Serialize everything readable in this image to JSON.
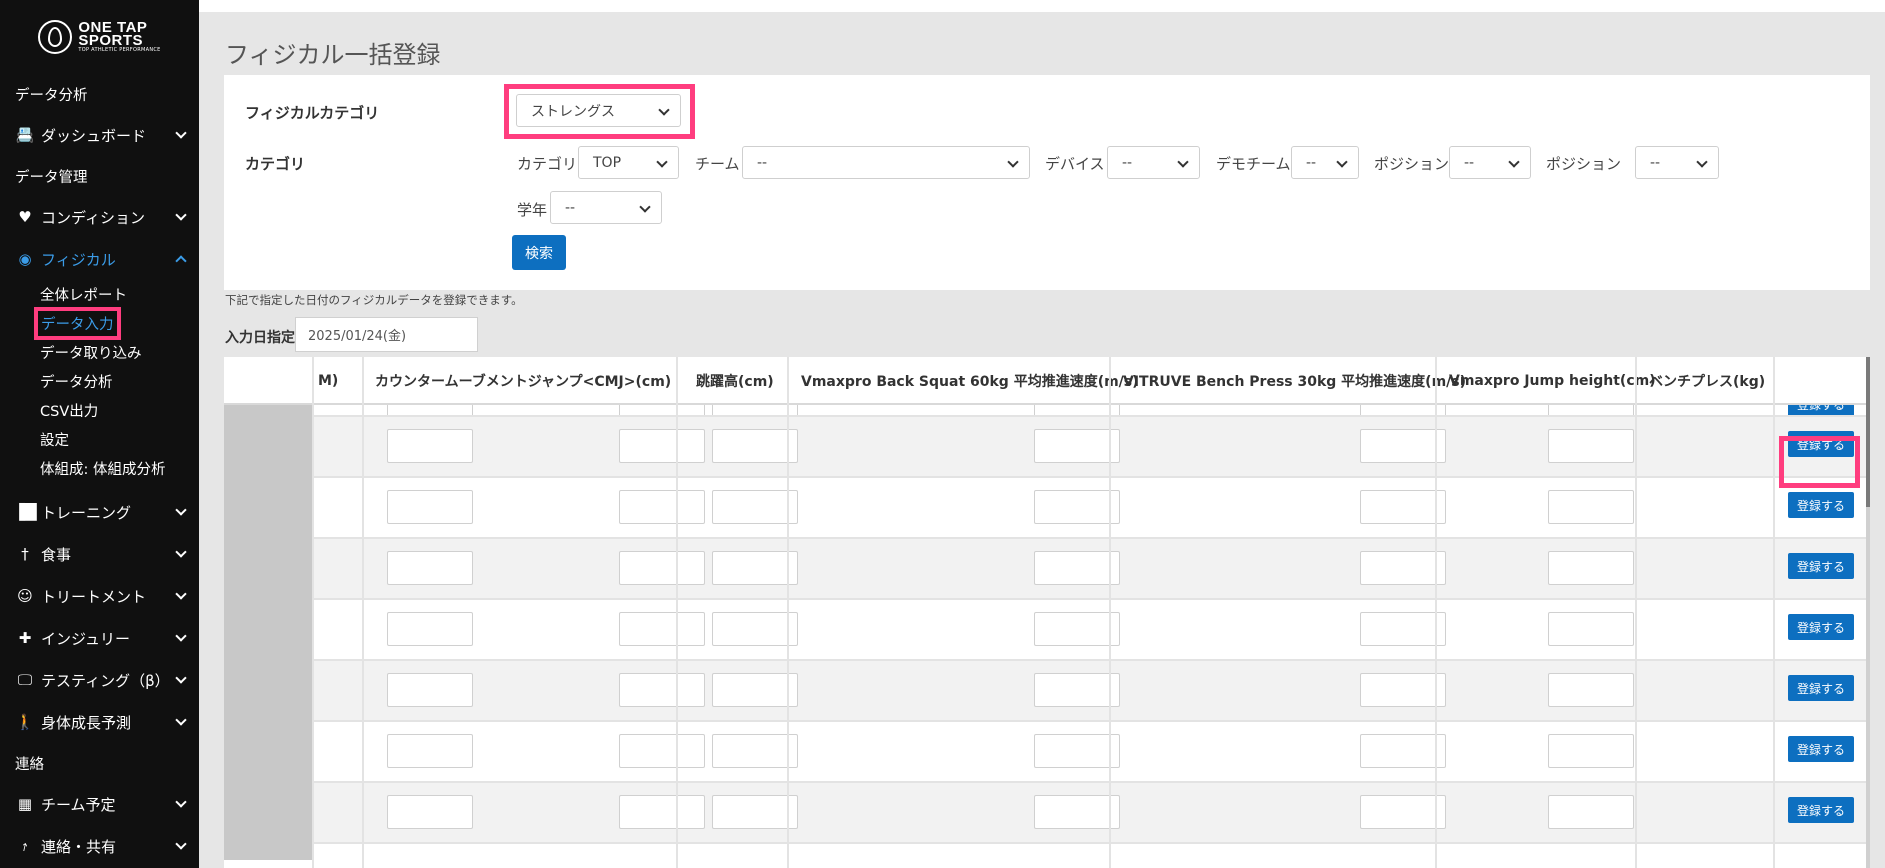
{
  "brand": {
    "line1": "ONE TAP",
    "line2": "SPORTS",
    "tagline": "TOP ATHLETIC PERFORMANCE"
  },
  "sidebar": {
    "section_analysis": "データ分析",
    "dashboard": "ダッシュボード",
    "section_management": "データ管理",
    "condition": "コンディション",
    "physical": "フィジカル",
    "physical_sub": [
      "全体レポート",
      "データ入力",
      "データ取り込み",
      "データ分析",
      "CSV出力",
      "設定",
      "体組成: 体組成分析"
    ],
    "training": "トレーニング",
    "meal": "食事",
    "treatment": "トリートメント",
    "injury": "インジュリー",
    "testing": "テスティング（β）",
    "growth": "身体成長予測",
    "section_contact": "連絡",
    "team_schedule": "チーム予定",
    "contact_share": "連絡・共有"
  },
  "page": {
    "title": "フィジカル一括登録"
  },
  "filters": {
    "physical_category_label": "フィジカルカテゴリ",
    "physical_category_value": "ストレングス",
    "category_label": "カテゴリ",
    "inline_category_label": "カテゴリ",
    "inline_category_value": "TOP",
    "team_label": "チーム",
    "team_value": "--",
    "device_label": "デバイス",
    "device_value": "--",
    "demo_team_label": "デモチーム",
    "demo_team_value": "--",
    "position_label": "ポジション",
    "position_value": "--",
    "position2_label": "ポジション",
    "position2_value": "--",
    "grade_label": "学年",
    "grade_value": "--",
    "search_button": "検索"
  },
  "note": "下記で指定した日付のフィジカルデータを登録できます。",
  "date": {
    "label": "入力日指定",
    "value": "2025/01/24(金)"
  },
  "table": {
    "headers": [
      "M)",
      "カウンタームーブメントジャンプ<CMJ>(cm)",
      "跳躍高(cm)",
      "Vmaxpro Back Squat 60kg 平均推進速度(m/s)",
      "VITRUVE Bench Press 30kg 平均推進速度(m/s)",
      "Vmaxpro Jump height(cm)",
      "ベンチプレス(kg)"
    ],
    "register_label": "登録する"
  },
  "colors": {
    "accent": "#0d6fc0",
    "highlight": "#ff3d7f",
    "sidebar_bg": "#101010",
    "active_link": "#3b9ce8"
  },
  "icons": [
    "id-card-icon",
    "heartbeat-icon",
    "user-circle-icon",
    "dumbbell-icon",
    "utensils-icon",
    "treatment-icon",
    "first-aid-icon",
    "testing-icon",
    "growth-icon",
    "calendar-icon",
    "share-icon"
  ]
}
